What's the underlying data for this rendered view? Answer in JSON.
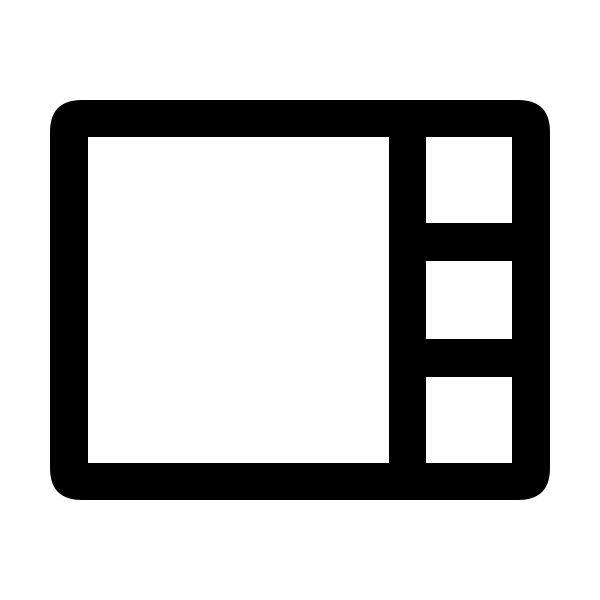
{
  "icon": {
    "name": "view-sidebar-layout-icon",
    "stroke_color": "#000000",
    "background_color": "#ffffff"
  }
}
